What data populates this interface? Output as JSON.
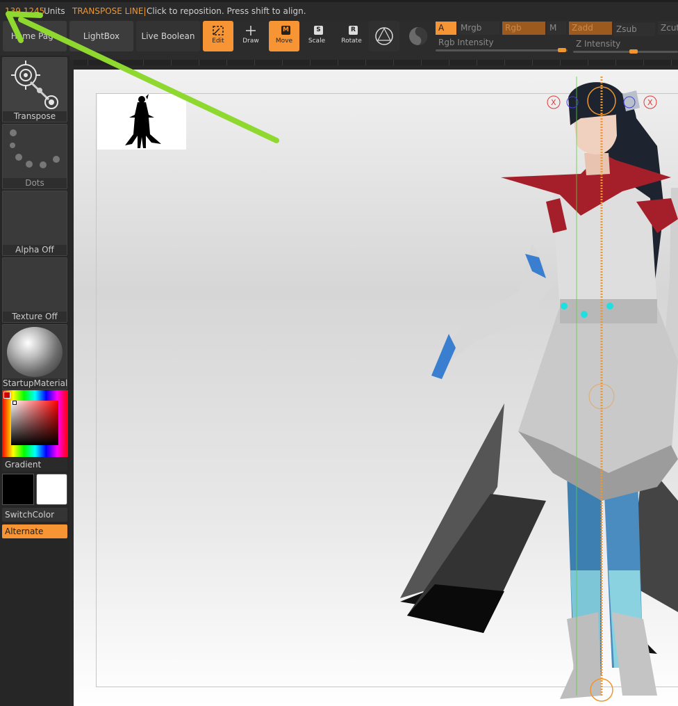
{
  "status": {
    "distance_value": "139.1245",
    "distance_unit": "Units",
    "mode": "TRANSPOSE LINE|",
    "hint": "Click to reposition. Press shift to align."
  },
  "toolbar": {
    "home_page": "Home Page",
    "lightbox": "LightBox",
    "live_boolean": "Live Boolean",
    "tools": [
      {
        "label": "Edit",
        "active": true
      },
      {
        "label": "Draw",
        "active": false
      },
      {
        "label": "Move",
        "active": true
      },
      {
        "label": "Scale",
        "active": false
      },
      {
        "label": "Rotate",
        "active": false
      }
    ],
    "a_label": "A",
    "mrgb": "Mrgb",
    "rgb": "Rgb",
    "m": "M",
    "zadd": "Zadd",
    "zsub": "Zsub",
    "zcut": "Zcut",
    "rgb_intensity": "Rgb Intensity",
    "z_intensity": "Z Intensity"
  },
  "sidebar": {
    "transpose": "Transpose",
    "dots": "Dots",
    "alpha": "Alpha Off",
    "texture": "Texture Off",
    "material": "StartupMaterial",
    "gradient": "Gradient",
    "switch_color": "SwitchColor",
    "alternate": "Alternate",
    "primary_color": "#000000",
    "secondary_color": "#ffffff"
  },
  "colors": {
    "accent": "#f79433",
    "annotation_arrow": "#8fd82f"
  },
  "gizmo": {
    "x_label": "X"
  }
}
